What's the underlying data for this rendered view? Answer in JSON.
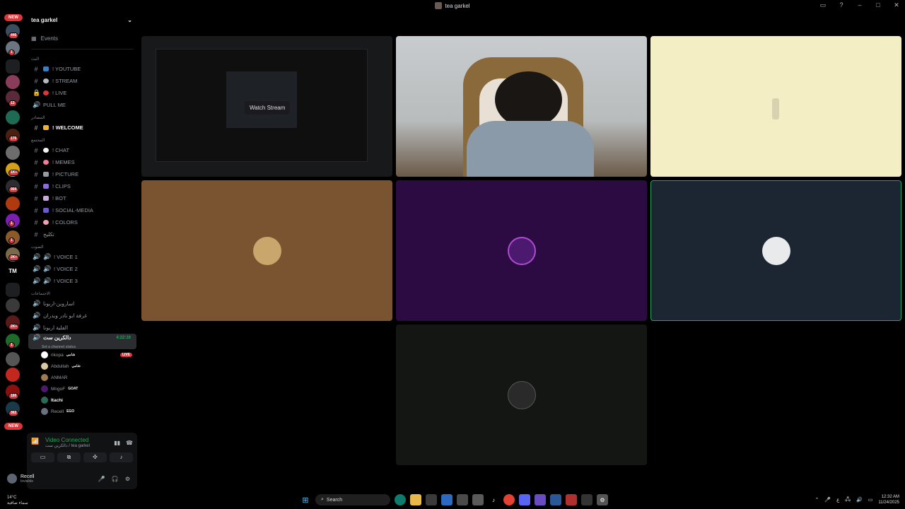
{
  "window": {
    "title": "tea garkel"
  },
  "rail": {
    "top_pill": "NEW",
    "bottom_pill": "NEW",
    "badges": [
      "446",
      "1",
      "13",
      "176",
      "1K+",
      "904",
      "1",
      "1",
      "2K+",
      "2K+",
      "1",
      "160",
      "362"
    ]
  },
  "server": {
    "name": "tea garkel",
    "events_label": "Events"
  },
  "categories": {
    "cat1": "البث",
    "cat2": "المصادر",
    "cat3": "المجتمع",
    "cat4": "الصوت",
    "cat5": "الاجتماعات"
  },
  "channels": {
    "youtube": "! YOUTUBE",
    "stream": "! STREAM",
    "live": "! LIVE",
    "pullme": "PULL ME",
    "welcome": "! WELCOME",
    "chat": "! CHAT",
    "memes": "! MEMES",
    "picture": "! PICTURE",
    "clips": "! CLIPS",
    "bot": "! BOT",
    "social": "! SOCIAL-MEDIA",
    "colors": "! COLORS",
    "arabic1": "تكليج",
    "voice1": "! VOICE 1",
    "voice2": "! VOICE 2",
    "voice3": "! VOICE 3",
    "meet1": "اساروين-اريونا",
    "meet2": "غرفة ابو نادر وبدران",
    "meet3": "الفلية اريونا",
    "current_vc": "دالكرين ست",
    "current_vc_time": "4:22:16",
    "current_vc_status": "Set a channel status"
  },
  "vc_users": [
    {
      "name": "rikopa",
      "tag": "شامي",
      "live": "LIVE"
    },
    {
      "name": "Abdullah",
      "tag": "شامي"
    },
    {
      "name": "ANMAR",
      "tag": ""
    },
    {
      "name": "MngoF",
      "tag": "GOAT"
    },
    {
      "name": "Itachi",
      "tag": ""
    },
    {
      "name": "Recell",
      "tag": "EGO"
    }
  ],
  "voice_panel": {
    "status": "Video Connected",
    "location": "دالكرين ست / tea garkel"
  },
  "user_panel": {
    "name": "Recell",
    "status": "Invisible"
  },
  "stage": {
    "watch_stream": "Watch Stream"
  },
  "taskbar": {
    "weather_temp": "14°C",
    "weather_desc": "سماء صافية",
    "search_placeholder": "Search",
    "time": "12:32 AM",
    "date": "11/24/2025",
    "lang": "ع"
  },
  "colors": {
    "tile_brown": "#7a5330",
    "tile_purple": "#2b0b42",
    "tile_navy": "#1c2532",
    "tile_cream": "#f4eec4",
    "tile_dark": "#141614",
    "accent_green": "#23a55a",
    "live_red": "#da373c"
  }
}
